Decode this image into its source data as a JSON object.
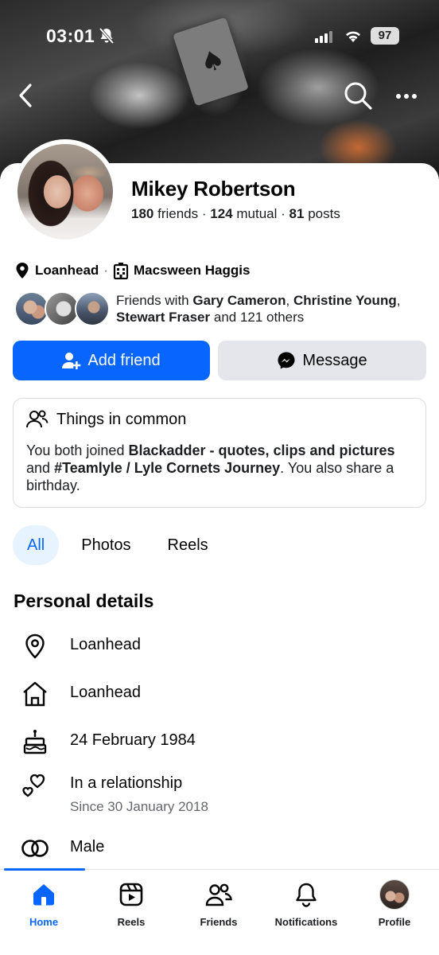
{
  "status_bar": {
    "time": "03:01",
    "battery": "97"
  },
  "profile": {
    "name": "Mikey Robertson",
    "friends_count": "180",
    "friends_label": "friends",
    "mutual_count": "124",
    "mutual_label": "mutual",
    "posts_count": "81",
    "posts_label": "posts",
    "location": "Loanhead",
    "workplace": "Macsween Haggis",
    "mutual_friends": {
      "prefix": "Friends with",
      "name1": "Gary Cameron",
      "name2": "Christine Young",
      "name3": "Stewart Fraser",
      "suffix": "and 121 others"
    }
  },
  "actions": {
    "add_friend": "Add friend",
    "message": "Message"
  },
  "things_in_common": {
    "title": "Things in common",
    "text_1": "You both joined",
    "group_1": "Blackadder - quotes, clips and pictures",
    "text_2": "and",
    "group_2": "#Teamlyle / Lyle Cornets Journey",
    "text_3": ". You also share a birthday."
  },
  "tabs": [
    "All",
    "Photos",
    "Reels"
  ],
  "personal_details": {
    "title": "Personal details",
    "current_city": "Loanhead",
    "hometown": "Loanhead",
    "birthday": "24 February 1984",
    "relationship": "In a relationship",
    "relationship_since": "Since 30 January 2018",
    "gender": "Male"
  },
  "nav": {
    "home": "Home",
    "reels": "Reels",
    "friends": "Friends",
    "notifications": "Notifications",
    "profile": "Profile"
  },
  "colors": {
    "accent": "#0866ff",
    "secondary_button": "#e4e6eb",
    "active_tab_bg": "#e7f3ff",
    "muted_text": "#65676b"
  },
  "icons": [
    "back-icon",
    "search-icon",
    "more-icon",
    "location-pin-icon",
    "workplace-icon",
    "add-friend-icon",
    "messenger-icon",
    "people-icon",
    "home-outline-icon",
    "cake-icon",
    "hearts-icon",
    "gender-icon",
    "home-icon",
    "reels-icon",
    "friends-icon",
    "bell-icon"
  ]
}
